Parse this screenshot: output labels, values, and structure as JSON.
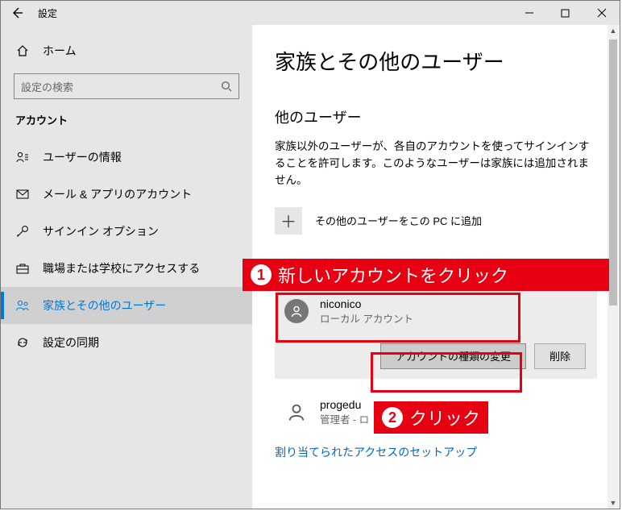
{
  "titlebar": {
    "title": "設定"
  },
  "sidebar": {
    "home": "ホーム",
    "search_placeholder": "設定の検索",
    "section": "アカウント",
    "items": [
      {
        "label": "ユーザーの情報"
      },
      {
        "label": "メール & アプリのアカウント"
      },
      {
        "label": "サインイン オプション"
      },
      {
        "label": "職場または学校にアクセスする"
      },
      {
        "label": "家族とその他のユーザー"
      },
      {
        "label": "設定の同期"
      }
    ]
  },
  "main": {
    "heading": "家族とその他のユーザー",
    "subheading": "他のユーザー",
    "description": "家族以外のユーザーが、各自のアカウントを使ってサインインすることを許可します。このようなユーザーは家族には追加されません。",
    "add_label": "その他のユーザーをこの PC に追加",
    "user1": {
      "name": "niconico",
      "type": "ローカル アカウント"
    },
    "change_btn": "アカウントの種類の変更",
    "delete_btn": "削除",
    "user2": {
      "name": "progedu",
      "type_prefix": "管理者 - ロ"
    },
    "link": "割り当てられたアクセスのセットアップ"
  },
  "annotations": {
    "a1": "新しいアカウントをクリック",
    "a2": "クリック"
  }
}
